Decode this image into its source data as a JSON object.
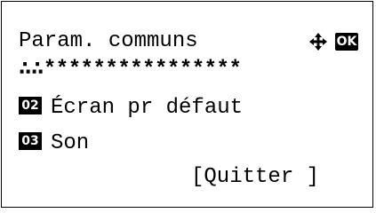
{
  "screen": {
    "title": "Param. communs",
    "ok_label": "OK",
    "separator": "****************",
    "separator_lead": "∴∴",
    "nav_icon": "four-way-arrow-icon"
  },
  "menu": {
    "items": [
      {
        "number": "02",
        "label": "Écran pr défaut"
      },
      {
        "number": "03",
        "label": "Son"
      }
    ]
  },
  "softkey": {
    "label": "[Quitter ]"
  },
  "colors": {
    "foreground": "#000000",
    "background": "#ffffff"
  }
}
